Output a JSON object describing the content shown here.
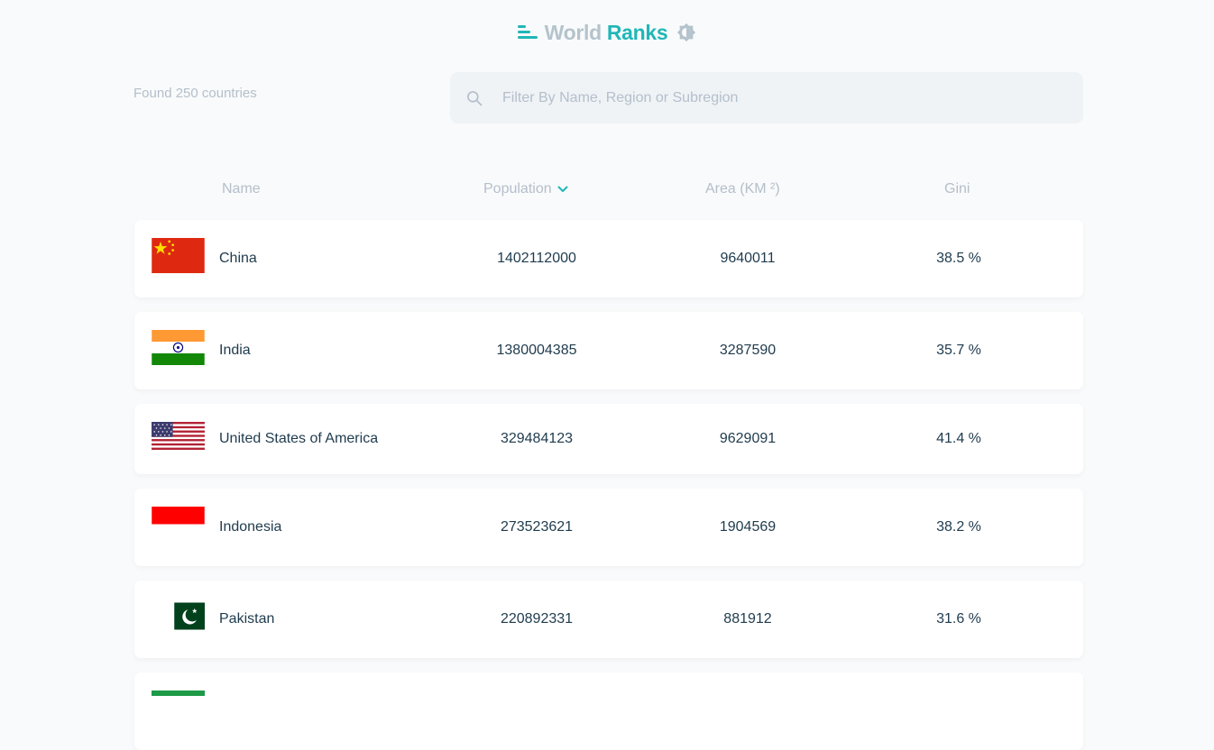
{
  "header": {
    "title_part1": "World",
    "title_part2": "Ranks",
    "logo_icon": "bars-logo-icon",
    "theme_icon": "brightness-icon"
  },
  "summary": {
    "found_text": "Found 250 countries"
  },
  "search": {
    "placeholder": "Filter By Name, Region or Subregion",
    "value": "",
    "icon": "search-icon"
  },
  "table": {
    "columns": {
      "name": "Name",
      "population": "Population",
      "area": "Area (KM ²)",
      "gini": "Gini"
    },
    "sort_indicator": "chevron-down-icon",
    "rows": [
      {
        "flag": "china-flag",
        "name": "China",
        "population": "1402112000",
        "area": "9640011",
        "gini": "38.5 %"
      },
      {
        "flag": "india-flag",
        "name": "India",
        "population": "1380004385",
        "area": "3287590",
        "gini": "35.7 %"
      },
      {
        "flag": "usa-flag",
        "name": "United States of America",
        "population": "329484123",
        "area": "9629091",
        "gini": "41.4 %"
      },
      {
        "flag": "indonesia-flag",
        "name": "Indonesia",
        "population": "273523621",
        "area": "1904569",
        "gini": "38.2 %"
      },
      {
        "flag": "pakistan-flag",
        "name": "Pakistan",
        "population": "220892331",
        "area": "881912",
        "gini": "31.6 %"
      }
    ]
  },
  "colors": {
    "accent": "#21b6b7",
    "muted": "#b4bfcb",
    "row_text": "#1f3b4d",
    "background": "#f9fafb"
  }
}
